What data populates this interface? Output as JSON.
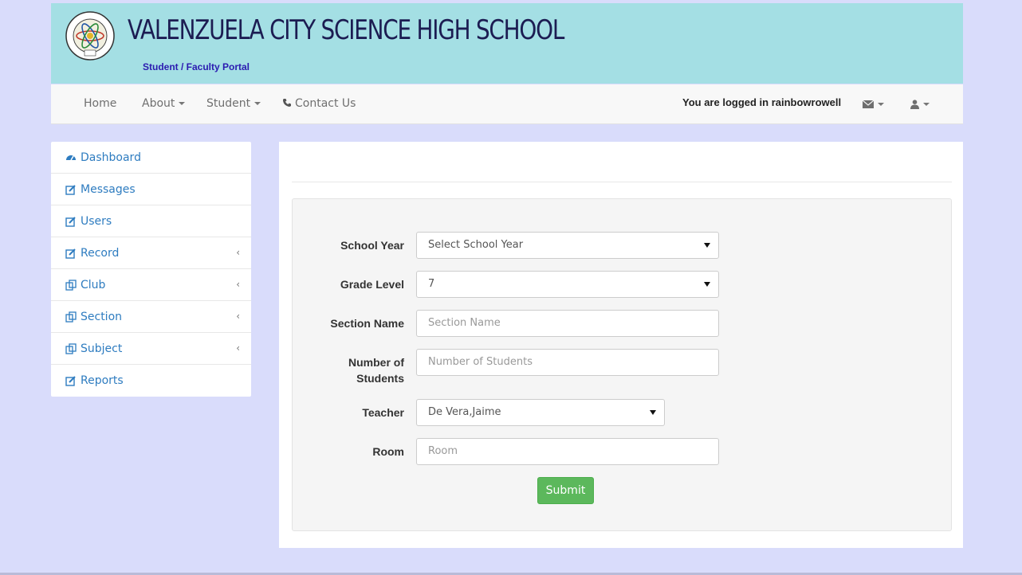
{
  "header": {
    "school_name": "VALENZUELA CITY SCIENCE HIGH SCHOOL",
    "portal_label": "Student / Faculty Portal",
    "seal_text": "VALENZUELA CITY SCIENCE HIGH SCHOOL 2003"
  },
  "navbar": {
    "home": "Home",
    "about": "About",
    "student": "Student",
    "contact": "Contact Us",
    "logged_in": "You are logged in rainbowrowell",
    "icons": [
      "envelope-icon",
      "user-icon"
    ]
  },
  "sidebar": {
    "items": [
      {
        "label": "Dashboard",
        "icon": "dashboard-icon"
      },
      {
        "label": "Messages",
        "icon": "edit-icon"
      },
      {
        "label": "Users",
        "icon": "edit-icon"
      },
      {
        "label": "Record",
        "icon": "edit-icon",
        "expandable": true
      },
      {
        "label": "Club",
        "icon": "copy-icon",
        "expandable": true
      },
      {
        "label": "Section",
        "icon": "copy-icon",
        "expandable": true
      },
      {
        "label": "Subject",
        "icon": "copy-icon",
        "expandable": true
      },
      {
        "label": "Reports",
        "icon": "edit-icon"
      }
    ]
  },
  "form": {
    "school_year": {
      "label": "School Year",
      "value": "Select School Year"
    },
    "grade_level": {
      "label": "Grade Level",
      "value": "7"
    },
    "section_name": {
      "label": "Section Name",
      "placeholder": "Section Name",
      "value": ""
    },
    "num_students": {
      "label_line1": "Number of",
      "label_line2": "Students",
      "placeholder": "Number of Students",
      "value": ""
    },
    "teacher": {
      "label": "Teacher",
      "value": "De Vera,Jaime"
    },
    "room": {
      "label": "Room",
      "placeholder": "Room",
      "value": ""
    },
    "submit_label": "Submit"
  },
  "colors": {
    "banner": "#a4dfe4",
    "page_bg": "#d9dcfb",
    "link": "#2e7cc0",
    "submit": "#5cb85c"
  }
}
